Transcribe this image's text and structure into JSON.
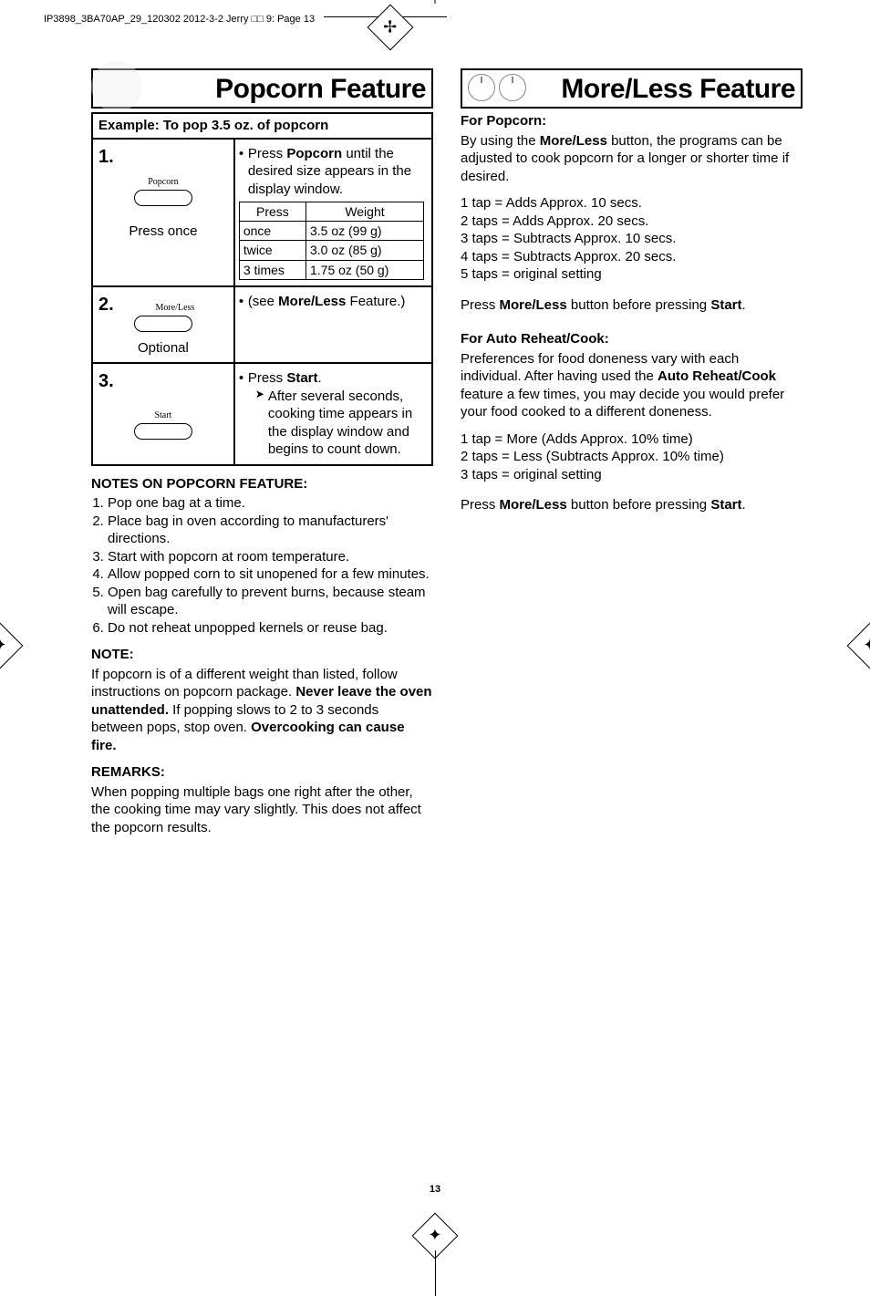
{
  "header_line": "IP3898_3BA70AP_29_120302  2012-3-2  Jerry  □□  9:   Page 13",
  "left": {
    "title": "Popcorn Feature",
    "example": "Example: To pop 3.5 oz. of popcorn",
    "step1": {
      "num": "1.",
      "label": "Popcorn",
      "press": "Press once",
      "desc_1": "Press ",
      "desc_b": "Popcorn",
      "desc_2": " until the desired size appears in the display window.",
      "thead_press": "Press",
      "thead_weight": "Weight",
      "r1a": "once",
      "r1b": "3.5 oz (99 g)",
      "r2a": "twice",
      "r2b": "3.0 oz (85 g)",
      "r3a": "3 times",
      "r3b": "1.75 oz (50 g)"
    },
    "step2": {
      "num": "2.",
      "label": "More/Less",
      "optional": "Optional",
      "desc_1": "(see ",
      "desc_b": "More/Less",
      "desc_2": " Feature.)"
    },
    "step3": {
      "num": "3.",
      "label": "Start",
      "desc_1": "Press ",
      "desc_b": "Start",
      "desc_2": ".",
      "sub": "After several seconds, cooking time appears in the display window and begins to count down."
    },
    "notes_head": "NOTES ON POPCORN FEATURE:",
    "notes": [
      "Pop one bag at a time.",
      "Place bag in oven according to manufacturers' directions.",
      "Start with popcorn at room temperature.",
      "Allow popped corn to sit unopened for a few minutes.",
      "Open bag carefully to prevent burns, because steam will escape.",
      "Do not reheat unpopped kernels or reuse bag."
    ],
    "note_head": "NOTE:",
    "note_body_1": "If popcorn is of a different weight than listed, follow instructions on popcorn package. ",
    "note_body_b1": "Never leave the oven unattended.",
    "note_body_2": " If popping slows to 2 to 3 seconds between pops, stop oven. ",
    "note_body_b2": "Overcooking can cause fire.",
    "remarks_head": "REMARKS:",
    "remarks_body": "When popping multiple bags one right after the other, the cooking time may vary slightly. This does not affect the popcorn results."
  },
  "right": {
    "title": "More/Less Feature",
    "popcorn_head": "For Popcorn:",
    "popcorn_body_1": "By using the ",
    "popcorn_body_b": "More/Less",
    "popcorn_body_2": " button, the programs can be adjusted to cook popcorn for a longer or shorter time if desired.",
    "taps": [
      "1 tap = Adds Approx. 10 secs.",
      "2 taps = Adds Approx. 20 secs.",
      "3 taps = Subtracts Approx. 10 secs.",
      "4 taps = Subtracts Approx. 20 secs.",
      "5 taps = original setting"
    ],
    "press_line_1a": "Press ",
    "press_line_1b": "More/Less",
    "press_line_1c": " button before pressing ",
    "press_line_1d": "Start",
    "press_line_1e": ".",
    "reheat_head": "For Auto Reheat/Cook:",
    "reheat_body_1": "Preferences for food doneness vary with each individual. After having used the ",
    "reheat_body_b": "Auto Reheat/Cook",
    "reheat_body_2": " feature a few times, you may decide you would prefer your food cooked to a different doneness.",
    "taps2": [
      "1 tap = More (Adds Approx. 10% time)",
      "2 taps = Less (Subtracts Approx. 10% time)",
      "3 taps = original setting"
    ]
  },
  "page_num": "13"
}
